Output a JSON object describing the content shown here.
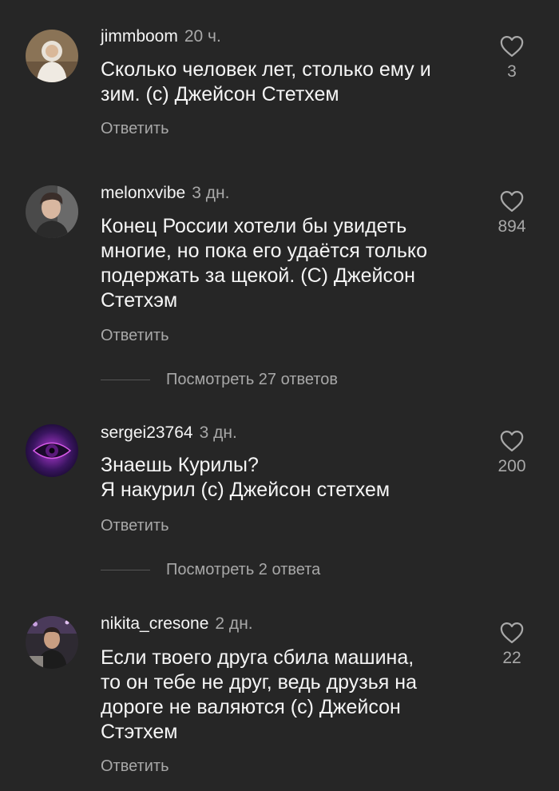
{
  "comments": [
    {
      "username": "jimmboom",
      "time": "20 ч.",
      "lines": [
        "Сколько человек лет, столько ему и",
        "зим. (с) Джейсон Стетхем"
      ],
      "likes": "3",
      "reply_label": "Ответить"
    },
    {
      "username": "melonxvibe",
      "time": "3 дн.",
      "lines": [
        "Конец России хотели бы увидеть",
        "многие, но пока его удаётся только",
        "подержать за щекой. (С) Джейсон",
        "Стетхэм"
      ],
      "likes": "894",
      "reply_label": "Ответить",
      "view_replies": "Посмотреть 27 ответов"
    },
    {
      "username": "sergei23764",
      "time": "3 дн.",
      "lines": [
        "Знаешь Курилы?",
        "Я накурил (с) Джейсон стетхем"
      ],
      "likes": "200",
      "reply_label": "Ответить",
      "view_replies": "Посмотреть 2 ответа"
    },
    {
      "username": "nikita_cresone",
      "time": "2 дн.",
      "lines": [
        "Если твоего друга сбила машина,",
        "то он тебе не друг, ведь друзья на",
        "дороге не валяются (с) Джейсон",
        "Стэтхем"
      ],
      "likes": "22",
      "reply_label": "Ответить"
    }
  ],
  "icons": {
    "like": "heart-outline-icon"
  },
  "colors": {
    "background": "#262626",
    "text_primary": "#f5f5f5",
    "text_secondary": "#a8a8a8"
  }
}
